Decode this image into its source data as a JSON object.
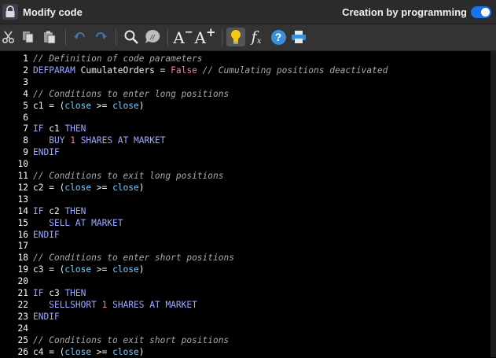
{
  "window": {
    "title": "Modify code"
  },
  "header": {
    "programming_toggle_label": "Creation by programming",
    "programming_toggle_on": true
  },
  "toolbar": {
    "font_decrease_label": "A",
    "font_decrease_sign": "−",
    "font_increase_label": "A",
    "font_increase_sign": "+",
    "function_label": "f",
    "function_sub": "x",
    "help_label": "?",
    "comment_label": "//"
  },
  "editor": {
    "lines": [
      {
        "n": "1",
        "parts": [
          {
            "t": "// Definition of code parameters",
            "c": "cmt"
          }
        ]
      },
      {
        "n": "2",
        "parts": [
          {
            "t": "DEFPARAM",
            "c": "kw"
          },
          {
            "t": " CumulateOrders = ",
            "c": ""
          },
          {
            "t": "False",
            "c": "bool"
          },
          {
            "t": " ",
            "c": ""
          },
          {
            "t": "// Cumulating positions deactivated",
            "c": "cmt"
          }
        ]
      },
      {
        "n": "3",
        "parts": []
      },
      {
        "n": "4",
        "parts": [
          {
            "t": "// Conditions to enter long positions",
            "c": "cmt"
          }
        ]
      },
      {
        "n": "5",
        "parts": [
          {
            "t": "c1 = (",
            "c": ""
          },
          {
            "t": "close",
            "c": "fn"
          },
          {
            "t": " >= ",
            "c": ""
          },
          {
            "t": "close",
            "c": "fn"
          },
          {
            "t": ")",
            "c": ""
          }
        ]
      },
      {
        "n": "6",
        "parts": []
      },
      {
        "n": "7",
        "parts": [
          {
            "t": "IF",
            "c": "kw"
          },
          {
            "t": " c1 ",
            "c": ""
          },
          {
            "t": "THEN",
            "c": "kw"
          }
        ]
      },
      {
        "n": "8",
        "parts": [
          {
            "t": "   ",
            "c": ""
          },
          {
            "t": "BUY",
            "c": "kw"
          },
          {
            "t": " ",
            "c": ""
          },
          {
            "t": "1",
            "c": "bool"
          },
          {
            "t": " ",
            "c": ""
          },
          {
            "t": "SHARES AT MARKET",
            "c": "kw"
          }
        ]
      },
      {
        "n": "9",
        "parts": [
          {
            "t": "ENDIF",
            "c": "kw"
          }
        ]
      },
      {
        "n": "10",
        "parts": []
      },
      {
        "n": "11",
        "parts": [
          {
            "t": "// Conditions to exit long positions",
            "c": "cmt"
          }
        ]
      },
      {
        "n": "12",
        "parts": [
          {
            "t": "c2 = (",
            "c": ""
          },
          {
            "t": "close",
            "c": "fn"
          },
          {
            "t": " >= ",
            "c": ""
          },
          {
            "t": "close",
            "c": "fn"
          },
          {
            "t": ")",
            "c": ""
          }
        ]
      },
      {
        "n": "13",
        "parts": []
      },
      {
        "n": "14",
        "parts": [
          {
            "t": "IF",
            "c": "kw"
          },
          {
            "t": " c2 ",
            "c": ""
          },
          {
            "t": "THEN",
            "c": "kw"
          }
        ]
      },
      {
        "n": "15",
        "parts": [
          {
            "t": "   ",
            "c": ""
          },
          {
            "t": "SELL AT MARKET",
            "c": "kw"
          }
        ]
      },
      {
        "n": "16",
        "parts": [
          {
            "t": "ENDIF",
            "c": "kw"
          }
        ]
      },
      {
        "n": "17",
        "parts": []
      },
      {
        "n": "18",
        "parts": [
          {
            "t": "// Conditions to enter short positions",
            "c": "cmt"
          }
        ]
      },
      {
        "n": "19",
        "parts": [
          {
            "t": "c3 = (",
            "c": ""
          },
          {
            "t": "close",
            "c": "fn"
          },
          {
            "t": " >= ",
            "c": ""
          },
          {
            "t": "close",
            "c": "fn"
          },
          {
            "t": ")",
            "c": ""
          }
        ]
      },
      {
        "n": "20",
        "parts": []
      },
      {
        "n": "21",
        "parts": [
          {
            "t": "IF",
            "c": "kw"
          },
          {
            "t": " c3 ",
            "c": ""
          },
          {
            "t": "THEN",
            "c": "kw"
          }
        ]
      },
      {
        "n": "22",
        "parts": [
          {
            "t": "   ",
            "c": ""
          },
          {
            "t": "SELLSHORT",
            "c": "kw"
          },
          {
            "t": " ",
            "c": ""
          },
          {
            "t": "1",
            "c": "bool"
          },
          {
            "t": " ",
            "c": ""
          },
          {
            "t": "SHARES AT MARKET",
            "c": "kw"
          }
        ]
      },
      {
        "n": "23",
        "parts": [
          {
            "t": "ENDIF",
            "c": "kw"
          }
        ]
      },
      {
        "n": "24",
        "parts": []
      },
      {
        "n": "25",
        "parts": [
          {
            "t": "// Conditions to exit short positions",
            "c": "cmt"
          }
        ]
      },
      {
        "n": "26",
        "parts": [
          {
            "t": "c4 = (",
            "c": ""
          },
          {
            "t": "close",
            "c": "fn"
          },
          {
            "t": " >= ",
            "c": ""
          },
          {
            "t": "close",
            "c": "fn"
          },
          {
            "t": ")",
            "c": ""
          }
        ]
      }
    ]
  },
  "colors": {
    "background": "#000000",
    "comment": "#a7a7b3",
    "keyword": "#9ea9ff",
    "function": "#7fc9ff",
    "boolean": "#ff7b9a",
    "toggle": "#1a73e8",
    "lightbulb": "#f5c518"
  }
}
